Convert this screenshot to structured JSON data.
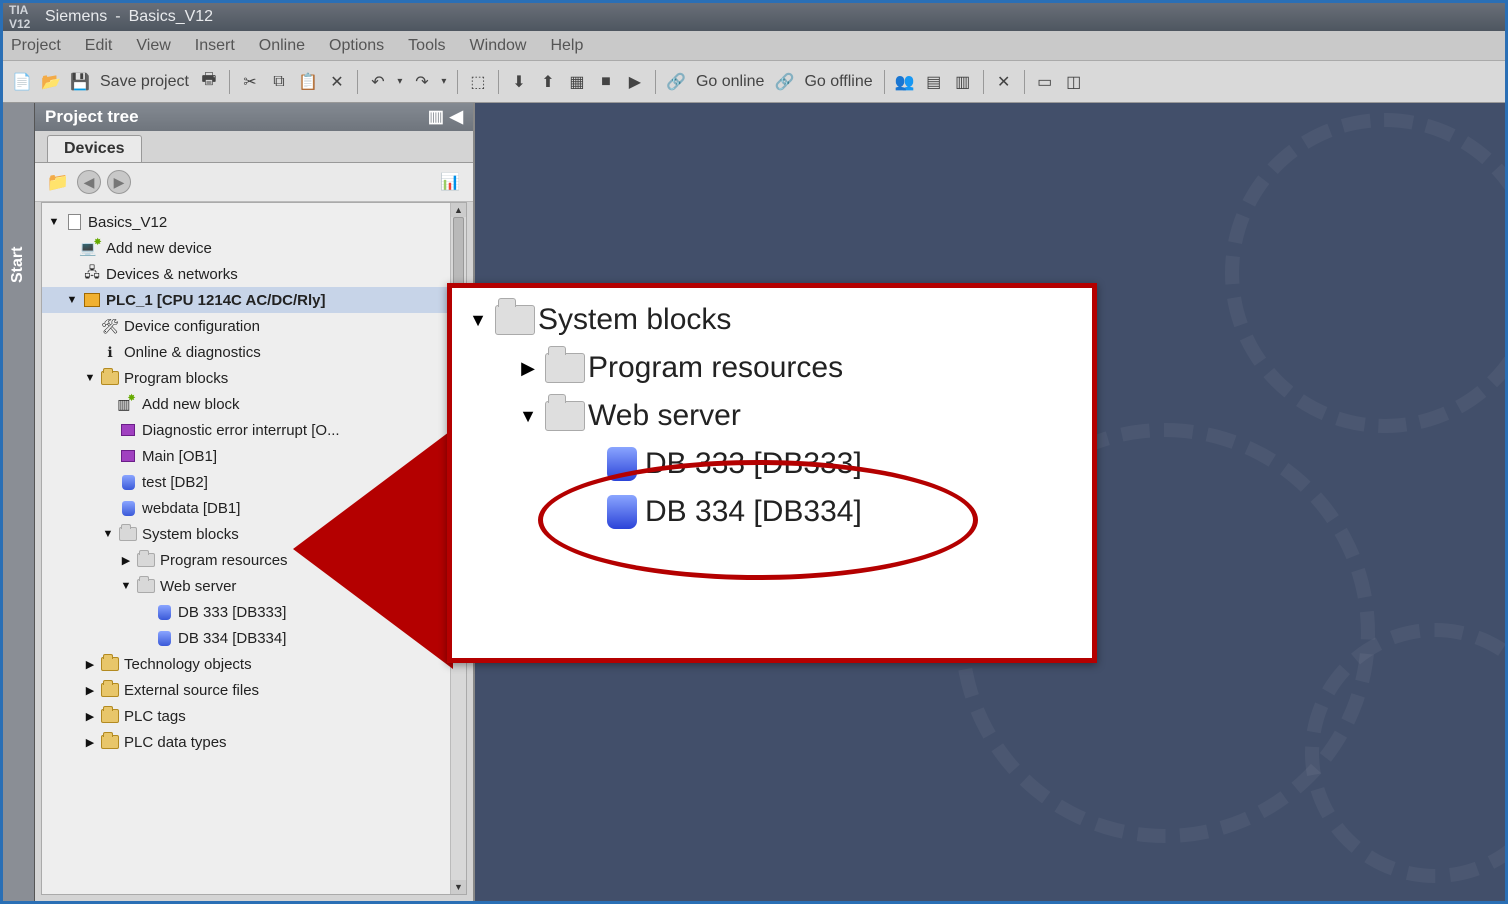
{
  "title_bar": {
    "app": "Siemens",
    "project": "Basics_V12",
    "logo": "TIA V12"
  },
  "menu": [
    "Project",
    "Edit",
    "View",
    "Insert",
    "Online",
    "Options",
    "Tools",
    "Window",
    "Help"
  ],
  "toolbar": {
    "save_label": "Save project",
    "go_online": "Go online",
    "go_offline": "Go offline"
  },
  "start_tab": "Start",
  "panel": {
    "title": "Project tree",
    "tab": "Devices"
  },
  "tree": {
    "root": "Basics_V12",
    "add_device": "Add new device",
    "devices_networks": "Devices & networks",
    "plc": "PLC_1 [CPU 1214C AC/DC/Rly]",
    "device_config": "Device configuration",
    "online_diag": "Online & diagnostics",
    "program_blocks": "Program blocks",
    "add_block": "Add new block",
    "diag_interrupt": "Diagnostic error interrupt [O...",
    "main_ob1": "Main [OB1]",
    "test_db2": "test [DB2]",
    "webdata_db1": "webdata [DB1]",
    "system_blocks": "System blocks",
    "program_resources": "Program resources",
    "web_server": "Web server",
    "db333": "DB 333 [DB333]",
    "db334": "DB 334 [DB334]",
    "tech_objects": "Technology objects",
    "ext_source": "External source files",
    "plc_tags": "PLC tags",
    "plc_datatypes": "PLC data types"
  },
  "callout": {
    "system_blocks": "System blocks",
    "program_resources": "Program resources",
    "web_server": "Web server",
    "db333": "DB 333 [DB333]",
    "db334": "DB 334 [DB334]"
  }
}
